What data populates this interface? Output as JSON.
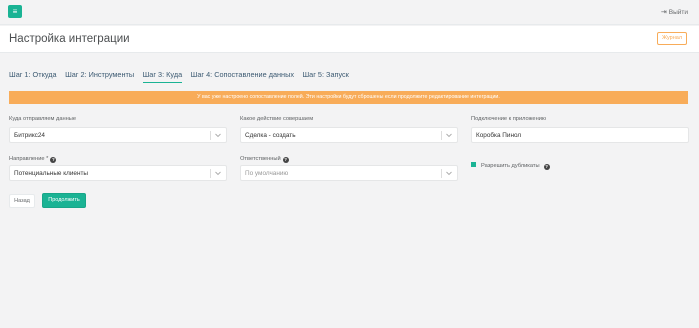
{
  "topbar": {
    "menu_icon": "≡",
    "logout_label": "Выйти",
    "logout_icon": "⇥"
  },
  "header": {
    "title": "Настройка интеграции",
    "journal_label": "Журнал"
  },
  "tabs": [
    {
      "label": "Шаг 1: Откуда"
    },
    {
      "label": "Шаг 2: Инструменты"
    },
    {
      "label": "Шаг 3: Куда"
    },
    {
      "label": "Шаг 4: Сопоставление данных"
    },
    {
      "label": "Шаг 5: Запуск"
    }
  ],
  "active_tab": 2,
  "alert": {
    "text": "У вас уже настроено сопоставление полей. Эти настройки будут сброшены если продолжите редактирование интеграции.",
    "color": "#f8ac59"
  },
  "form": {
    "send_to": {
      "label": "Куда отправляем данные",
      "value": "Битрикс24"
    },
    "action": {
      "label": "Какое действие совершаем",
      "value": "Сделка - создать"
    },
    "connection": {
      "label": "Подключение к приложению",
      "value": "Коробка Пинол"
    },
    "direction": {
      "label": "Направление",
      "required": "*",
      "value": "Потенциальные клиенты"
    },
    "responsible": {
      "label": "Ответственный",
      "placeholder": "По умолчанию"
    },
    "allow_duplicates": {
      "label": "Разрешить дубликаты",
      "checked": true
    }
  },
  "help_icon": "?",
  "buttons": {
    "back": "Назад",
    "next": "Продолжить"
  },
  "colors": {
    "accent": "#1ab394",
    "warning": "#f8ac59",
    "tab_text": "#3c5a72"
  }
}
